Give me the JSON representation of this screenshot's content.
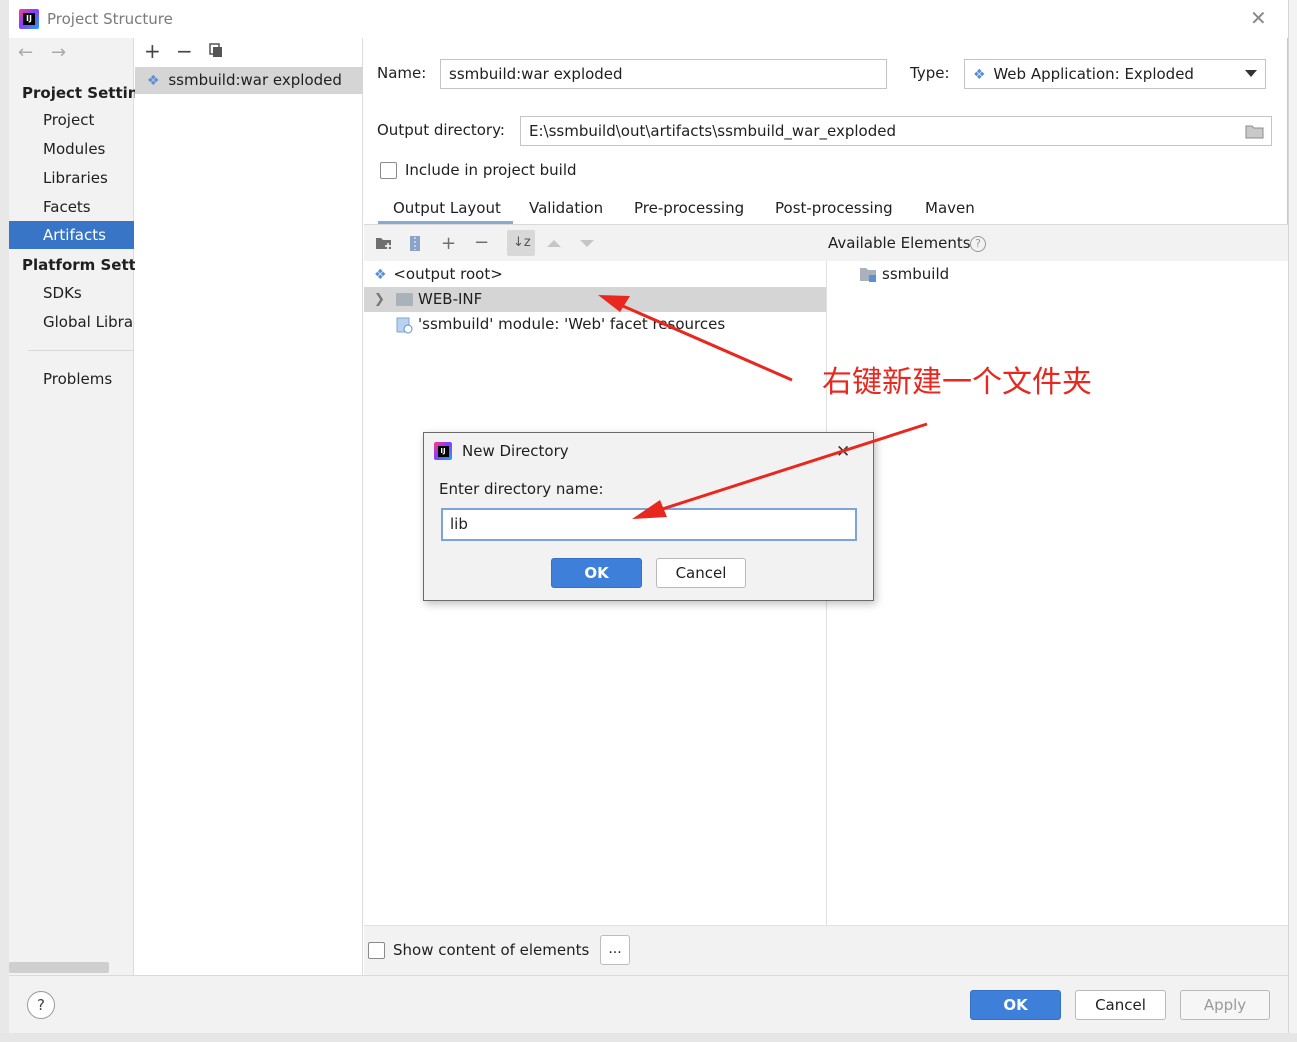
{
  "window": {
    "title": "Project Structure"
  },
  "nav": {
    "sections": [
      {
        "label": "Project Setting",
        "items": [
          "Project",
          "Modules",
          "Libraries",
          "Facets",
          "Artifacts"
        ]
      },
      {
        "label": "Platform Settin",
        "items": [
          "SDKs",
          "Global Librar"
        ]
      }
    ],
    "extra_item": "Problems",
    "selected": "Artifacts"
  },
  "artifacts": {
    "items": [
      "ssmbuild:war exploded"
    ]
  },
  "config": {
    "name_label": "Name:",
    "name_value": "ssmbuild:war exploded",
    "type_label": "Type:",
    "type_value": "Web Application: Exploded",
    "output_label": "Output directory:",
    "output_value": "E:\\ssmbuild\\out\\artifacts\\ssmbuild_war_exploded",
    "include_label": "Include in project build",
    "include_checked": false
  },
  "tabs": [
    "Output Layout",
    "Validation",
    "Pre-processing",
    "Post-processing",
    "Maven"
  ],
  "active_tab": "Output Layout",
  "layout_tree": {
    "root": "<output root>",
    "children": [
      "WEB-INF",
      "'ssmbuild' module: 'Web' facet resources"
    ]
  },
  "available": {
    "header": "Available Elements",
    "items": [
      "ssmbuild"
    ]
  },
  "bottom": {
    "show_content_label": "Show content of elements",
    "dots_label": "..."
  },
  "footer": {
    "help": "?",
    "ok": "OK",
    "cancel": "Cancel",
    "apply": "Apply"
  },
  "dialog": {
    "title": "New Directory",
    "prompt": "Enter directory name:",
    "value": "lib",
    "ok": "OK",
    "cancel": "Cancel"
  },
  "annotation": {
    "text": "右键新建一个文件夹",
    "color": "#e8281f"
  },
  "colors": {
    "selection": "#3875c7",
    "primary_button": "#3d7fd9"
  }
}
